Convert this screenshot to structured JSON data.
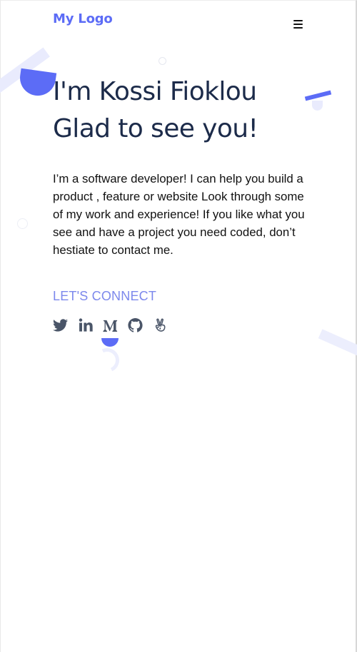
{
  "header": {
    "logo_text": "My Logo",
    "menu_icon": "hamburger-menu-icon"
  },
  "hero": {
    "title_line1": "I'm Kossi Fioklou",
    "title_line2": "Glad to see you!",
    "bio": "I’m a software developer! I can help you build a product , feature or website Look through some of my work and experience! If you like what you see and have a project you need coded, don’t hestiate to contact me.",
    "connect_label": "LET'S CONNECT"
  },
  "social": [
    {
      "name": "twitter",
      "icon": "twitter-icon"
    },
    {
      "name": "linkedin",
      "icon": "linkedin-icon"
    },
    {
      "name": "medium",
      "icon": "medium-icon"
    },
    {
      "name": "github",
      "icon": "github-icon"
    },
    {
      "name": "angellist",
      "icon": "angellist-icon"
    }
  ],
  "colors": {
    "accent": "#5c6cf6",
    "accent_light": "#e9ebfd",
    "connect_text": "#7c88ec",
    "title_text": "#1c2b4a",
    "icon": "#4a5568"
  }
}
